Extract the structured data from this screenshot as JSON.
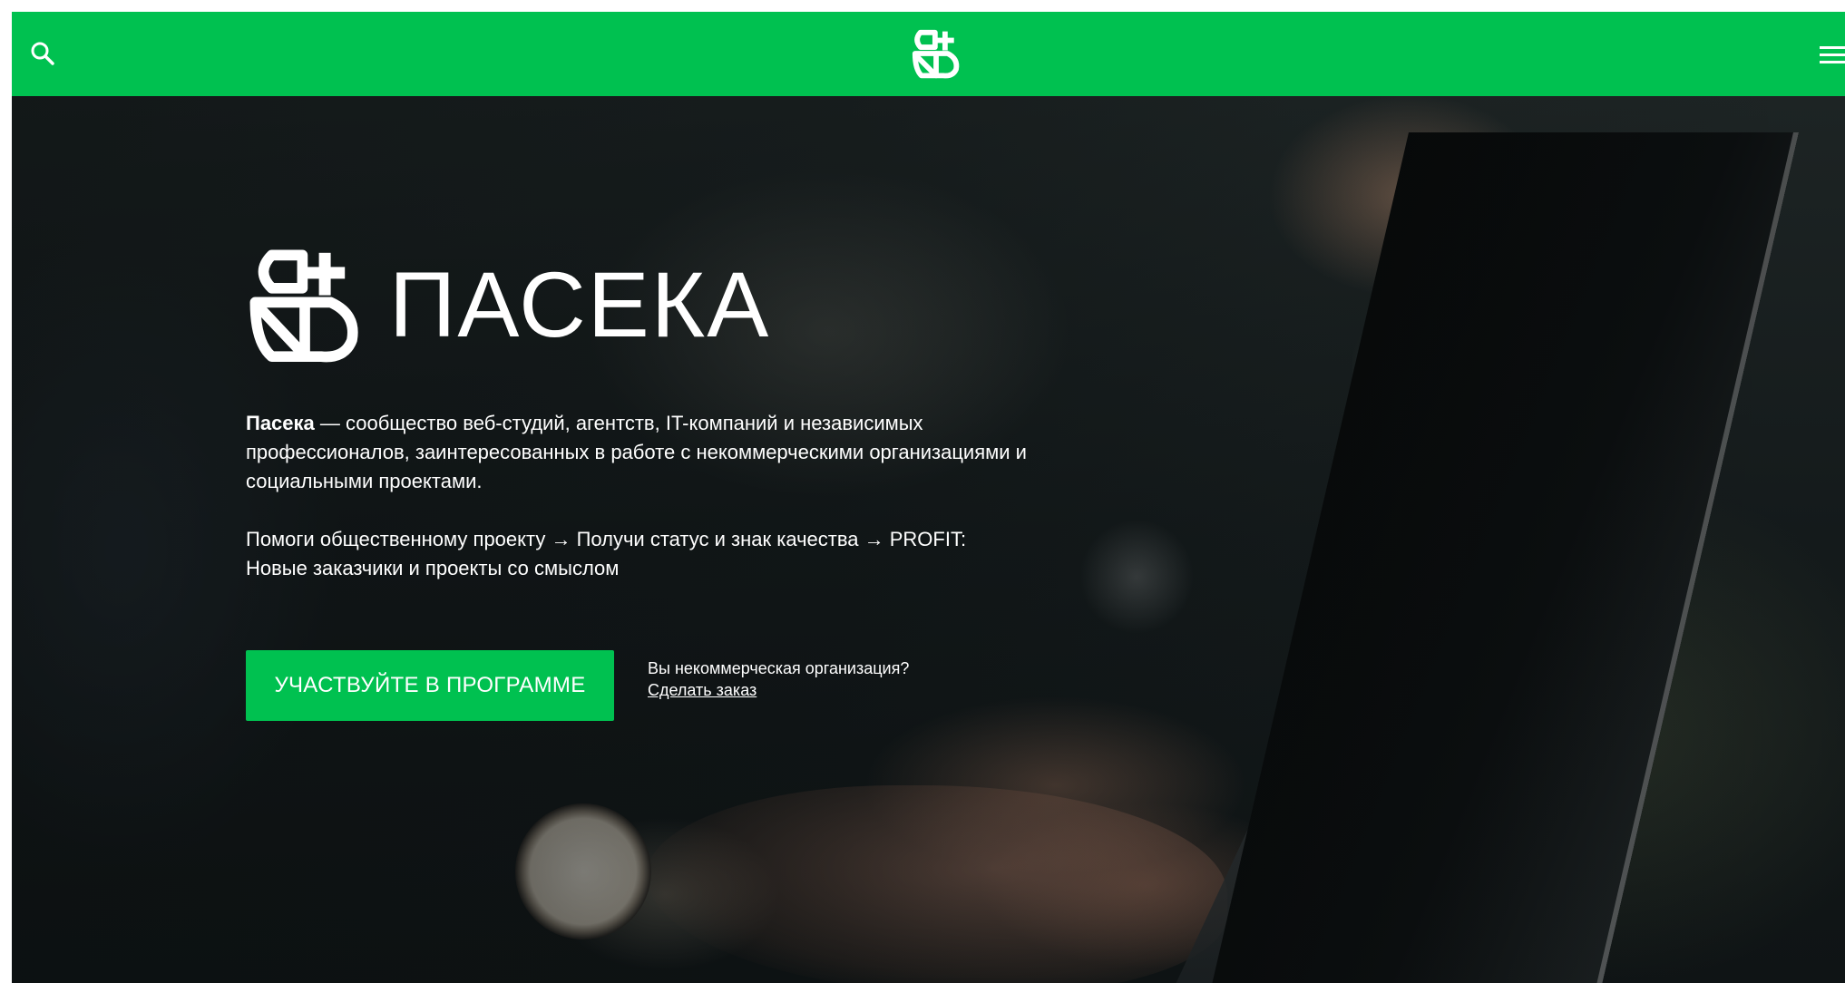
{
  "header": {
    "search_icon": "search-icon",
    "logo_icon": "bee-logo-icon",
    "menu_icon": "hamburger-menu-icon",
    "background_color": "#00c150"
  },
  "hero": {
    "brand_name": "ПАСЕКА",
    "intro_bold": "Пасека",
    "intro_rest": " — сообщество веб-студий, агентств, IT-компаний и независимых профессионалов, заинтересованных в работе с некоммерческими организациями и социальными проектами.",
    "steps_line1": "Помоги общественному проекту → Получи статус и знак качества → PROFIT:",
    "steps_line2": "Новые заказчики и проекты со смыслом",
    "cta_label": "УЧАСТВУЙТЕ В ПРОГРАММЕ",
    "nonprofit_question": "Вы некоммерческая организация?",
    "order_link": "Сделать заказ",
    "accent_color": "#00c150"
  }
}
